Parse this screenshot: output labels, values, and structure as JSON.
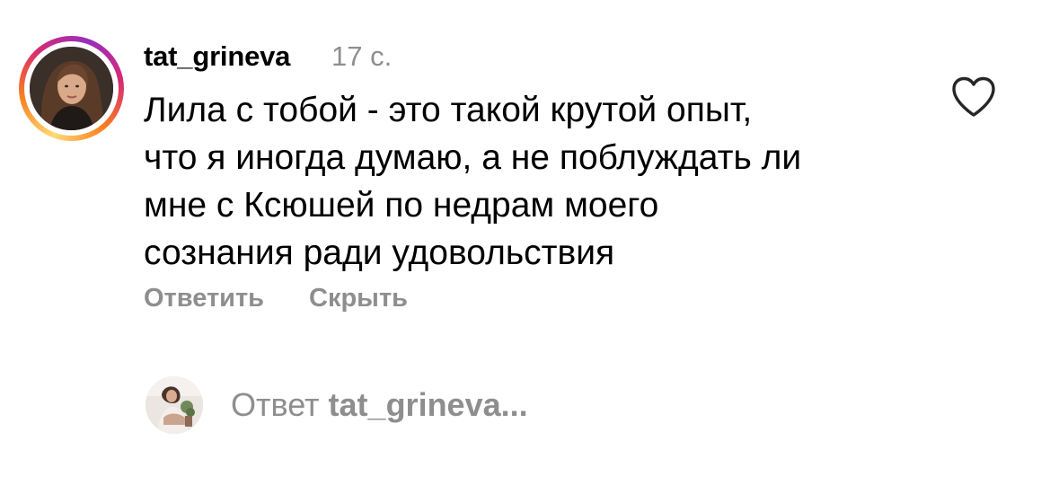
{
  "comment": {
    "username": "tat_grineva",
    "timestamp": "17 с.",
    "text_lines": [
      "Лила с тобой - это такой крутой опыт,",
      "что я иногда думаю, а не поблуждать ли",
      "мне с Ксюшей по недрам моего",
      "сознания ради удовольствия"
    ],
    "like_icon": "heart-outline-icon",
    "actions": {
      "reply_label": "Ответить",
      "hide_label": "Скрыть"
    }
  },
  "reply_box": {
    "prefix": "Ответ",
    "mention": "tat_grineva..."
  },
  "colors": {
    "text": "#000000",
    "muted": "#8e8e8e",
    "story_ring_gradient": [
      "#feda75",
      "#fa7e1e",
      "#d62976",
      "#962fbf"
    ]
  }
}
